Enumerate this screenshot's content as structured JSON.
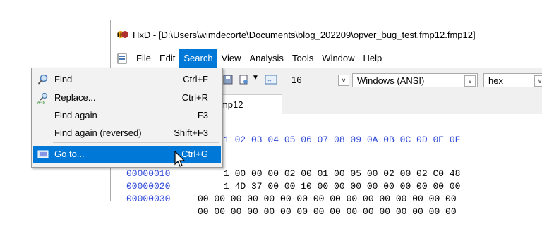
{
  "window": {
    "title": "HxD - [D:\\Users\\wimdecorte\\Documents\\blog_202209\\opver_bug_test.fmp12.fmp12]",
    "app_icon": "hxd-app-icon"
  },
  "menubar": {
    "items": [
      "File",
      "Edit",
      "Search",
      "View",
      "Analysis",
      "Tools",
      "Window",
      "Help"
    ],
    "active": "Search"
  },
  "toolbar": {
    "bytes_per_row": "16",
    "charset": "Windows (ANSI)",
    "display": "hex"
  },
  "tab": {
    "label": "p12.fmp12"
  },
  "hex": {
    "header": "1 02 03 04 05 06 07 08 09 0A 0B 0C 0D 0E 0F",
    "rows": [
      {
        "offset": "00000000",
        "bytes": "1 00 00 00 02 00 01 00 05 00 02 00 02 C0 48"
      },
      {
        "offset": "00000010",
        "bytes": "1 4D 37 00 00 10 00 00 00 00 00 00 00 00 00"
      },
      {
        "offset": "00000020",
        "bytes": "00 00 00 00 00 00 00 00 00 00 00 00 00 00 00 00"
      },
      {
        "offset": "00000030",
        "bytes": "00 00 00 00 00 00 00 00 00 00 00 00 00 00 00 00"
      }
    ]
  },
  "search_menu": {
    "items": [
      {
        "label": "Find",
        "shortcut": "Ctrl+F",
        "icon": "find-icon"
      },
      {
        "label": "Replace...",
        "shortcut": "Ctrl+R",
        "icon": "replace-icon"
      },
      {
        "label": "Find again",
        "shortcut": "F3",
        "icon": ""
      },
      {
        "label": "Find again (reversed)",
        "shortcut": "Shift+F3",
        "icon": ""
      },
      {
        "label": "Go to...",
        "shortcut": "Ctrl+G",
        "icon": "goto-icon",
        "highlighted": true
      }
    ]
  },
  "colors": {
    "highlight": "#0078d7",
    "offset": "#2f49d6"
  }
}
